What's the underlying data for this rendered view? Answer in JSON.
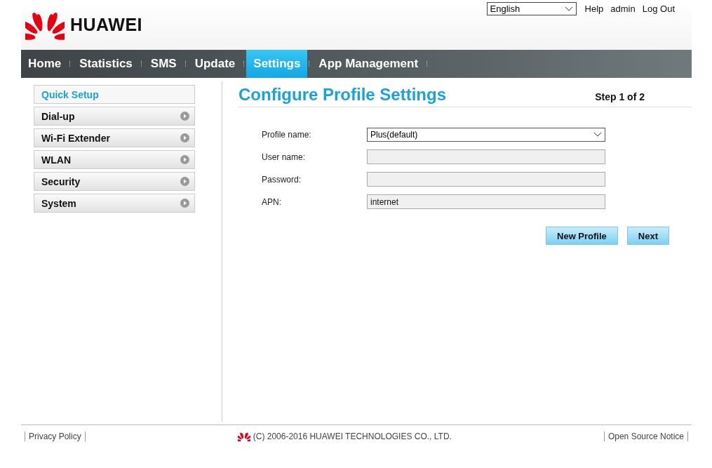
{
  "header": {
    "brand": "HUAWEI",
    "language": "English",
    "links": [
      "Help",
      "admin",
      "Log Out"
    ]
  },
  "nav": {
    "items": [
      {
        "label": "Home",
        "selected": false
      },
      {
        "label": "Statistics",
        "selected": false
      },
      {
        "label": "SMS",
        "selected": false
      },
      {
        "label": "Update",
        "selected": false
      },
      {
        "label": "Settings",
        "selected": true
      },
      {
        "label": "App Management",
        "selected": false
      }
    ]
  },
  "sidebar": {
    "items": [
      {
        "label": "Quick Setup",
        "kind": "link",
        "selected": true
      },
      {
        "label": "Dial-up",
        "kind": "group",
        "selected": false
      },
      {
        "label": "Wi-Fi Extender",
        "kind": "group",
        "selected": false
      },
      {
        "label": "WLAN",
        "kind": "group",
        "selected": false
      },
      {
        "label": "Security",
        "kind": "group",
        "selected": false
      },
      {
        "label": "System",
        "kind": "group",
        "selected": false
      }
    ]
  },
  "main": {
    "title": "Configure Profile Settings",
    "step": "Step 1 of 2",
    "fields": [
      {
        "label": "Profile name:",
        "kind": "select",
        "value": "Plus(default)"
      },
      {
        "label": "User name:",
        "kind": "text"
      },
      {
        "label": "Password:",
        "kind": "text"
      },
      {
        "label": "APN:",
        "kind": "text",
        "value": "internet"
      }
    ],
    "buttons": [
      "New Profile",
      "Next"
    ]
  },
  "footer": {
    "left": "Privacy Policy",
    "copyright": "(C) 2006-2016 HUAWEI TECHNOLOGIES CO., LTD.",
    "right": "Open Source Notice"
  }
}
